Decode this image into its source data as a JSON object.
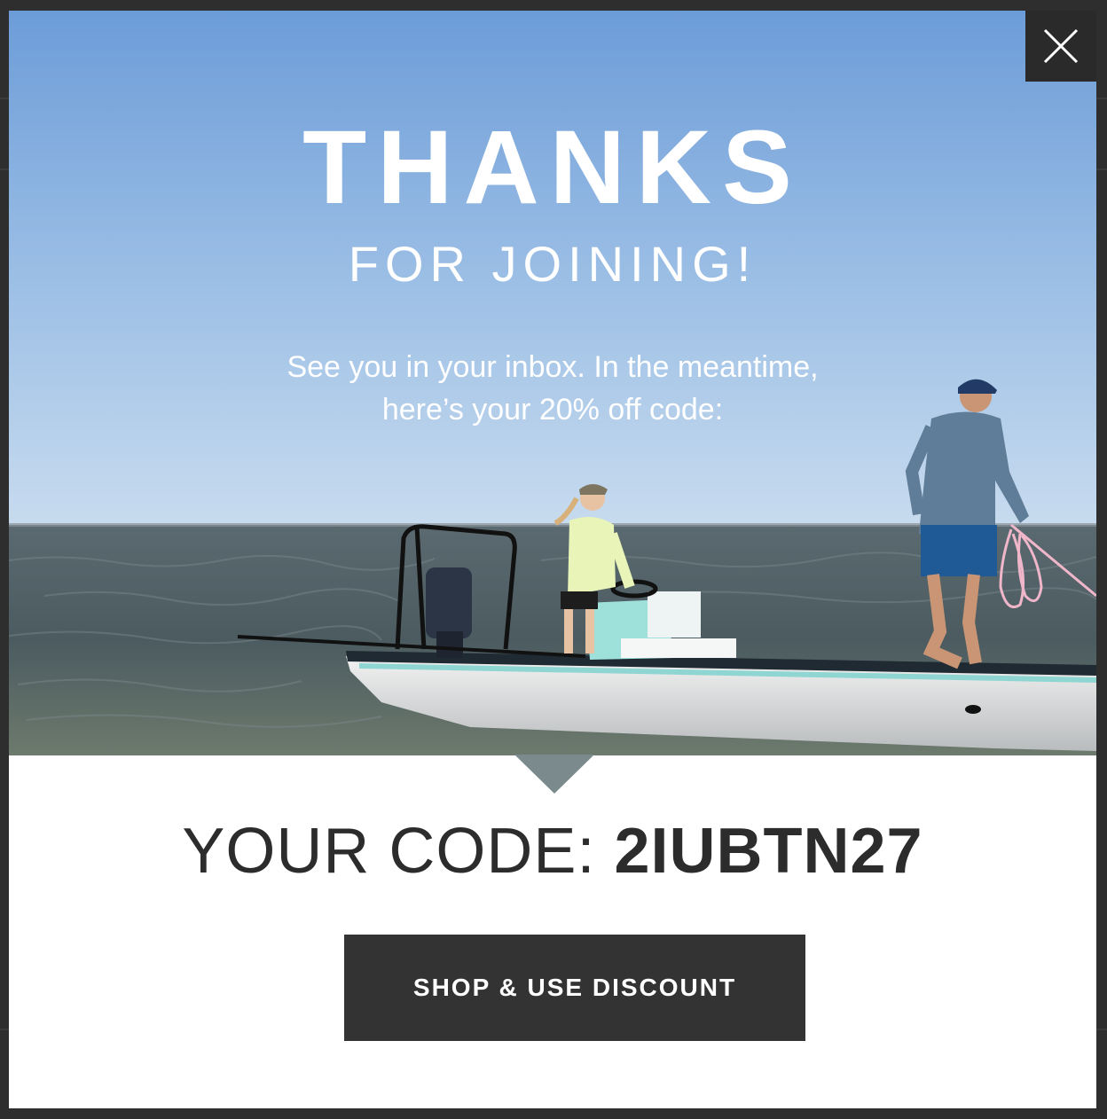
{
  "popup": {
    "headline": "THANKS",
    "subheadline": "FOR JOINING!",
    "message_line1": "See you in your inbox. In the meantime,",
    "message_line2": "here’s your 20% off code:",
    "code_label": "YOUR CODE: ",
    "code_value": "2IUBTN27",
    "cta_label": "SHOP & USE DISCOUNT",
    "close_icon": "close-icon"
  },
  "colors": {
    "cta_background": "#333333",
    "code_text": "#2c2c2c",
    "close_background": "#2a2a2a",
    "sky_top": "#6f9fd8",
    "water": "#4e5f66"
  }
}
